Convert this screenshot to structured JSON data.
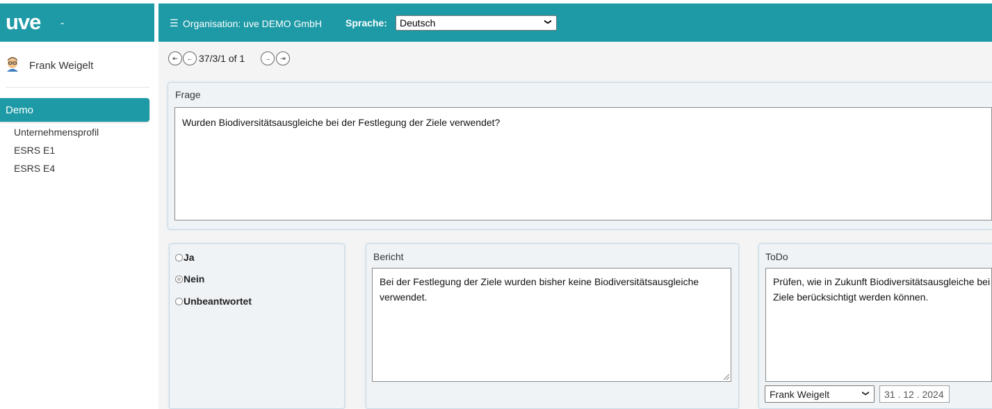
{
  "brand": {
    "logo": "uve",
    "logo_suffix": "-"
  },
  "header": {
    "menu_icon": "hamburger-icon",
    "organisation": "Organisation: uve DEMO GmbH",
    "language_label": "Sprache:",
    "language_value": "Deutsch"
  },
  "sidebar": {
    "user_name": "Frank Weigelt",
    "active_item": "Demo",
    "items": [
      "Unternehmensprofil",
      "ESRS E1",
      "ESRS E4"
    ]
  },
  "pager": {
    "text": "37/3/1 of 1",
    "buttons": [
      "first-icon",
      "prev-icon",
      "next-icon",
      "last-icon"
    ]
  },
  "question": {
    "title": "Frage",
    "text": "Wurden Biodiversitätsausgleiche bei der Festlegung der Ziele verwendet?"
  },
  "answers": {
    "options": [
      "Ja",
      "Nein",
      "Unbeantwortet"
    ],
    "selected": "Nein"
  },
  "report": {
    "title": "Bericht",
    "text": "Bei der Festlegung der Ziele wurden bisher keine Biodiversitätsausgleiche verwendet."
  },
  "todo": {
    "title": "ToDo",
    "text": "Prüfen, wie in Zukunft Biodiversitätsausgleiche bei der Festlegung der Ziele berücksichtigt werden können.",
    "assignee": "Frank Weigelt",
    "due_date": "31 . 12 . 2024"
  },
  "colors": {
    "accent": "#1d9aa6",
    "panel_border": "#c8dbe7"
  }
}
